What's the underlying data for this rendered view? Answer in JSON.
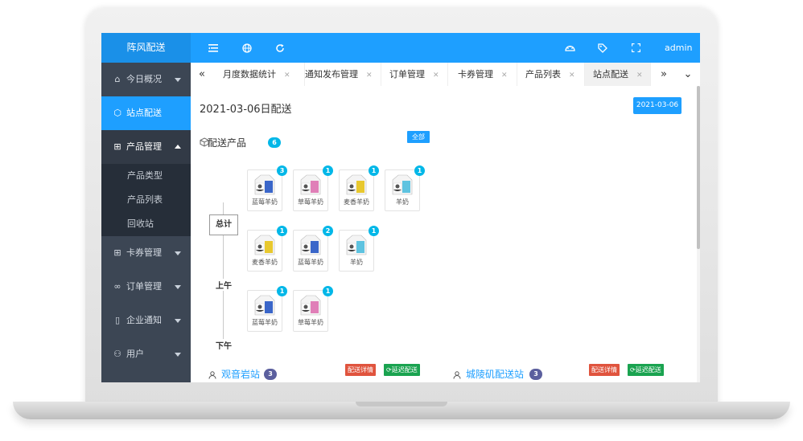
{
  "app": {
    "brand": "阵风配送",
    "user": "admin"
  },
  "sidebar": {
    "items": [
      {
        "label": "今日概况"
      },
      {
        "label": "站点配送"
      },
      {
        "label": "产品管理",
        "children": [
          {
            "label": "产品类型"
          },
          {
            "label": "产品列表"
          },
          {
            "label": "回收站"
          }
        ]
      },
      {
        "label": "卡券管理"
      },
      {
        "label": "订单管理"
      },
      {
        "label": "企业通知"
      },
      {
        "label": "用户"
      }
    ]
  },
  "tabs": [
    {
      "label": "月度数据统计"
    },
    {
      "label": "通知发布管理"
    },
    {
      "label": "订单管理"
    },
    {
      "label": "卡券管理"
    },
    {
      "label": "产品列表"
    },
    {
      "label": "站点配送"
    }
  ],
  "main": {
    "title": "2021-03-06日配送",
    "date_button": "2021-03-06",
    "section_title": "配送产品",
    "section_count": "6",
    "all_button": "全部",
    "groups": [
      {
        "label": "总计",
        "items": [
          {
            "name": "蓝莓羊奶",
            "qty": "3",
            "color": "#3a66c9"
          },
          {
            "name": "草莓羊奶",
            "qty": "1",
            "color": "#e07fb8"
          },
          {
            "name": "麦香羊奶",
            "qty": "1",
            "color": "#e8c82e"
          },
          {
            "name": "羊奶",
            "qty": "1",
            "color": "#5ec3e0"
          }
        ]
      },
      {
        "label": "上午",
        "items": [
          {
            "name": "麦香羊奶",
            "qty": "1",
            "color": "#e8c82e"
          },
          {
            "name": "蓝莓羊奶",
            "qty": "2",
            "color": "#3a66c9"
          },
          {
            "name": "羊奶",
            "qty": "1",
            "color": "#5ec3e0"
          }
        ]
      },
      {
        "label": "下午",
        "items": [
          {
            "name": "蓝莓羊奶",
            "qty": "1",
            "color": "#3a66c9"
          },
          {
            "name": "草莓羊奶",
            "qty": "1",
            "color": "#e07fb8"
          }
        ]
      }
    ],
    "stations": [
      {
        "name": "观音岩站",
        "count": "3",
        "detail_label": "配送详情",
        "delay_label": "延迟配送"
      },
      {
        "name": "城陵矶配送站",
        "count": "3",
        "detail_label": "配送详情",
        "delay_label": "延迟配送"
      }
    ]
  }
}
